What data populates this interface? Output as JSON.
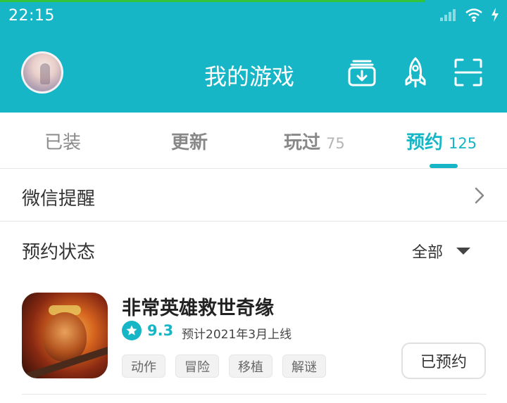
{
  "status_bar": {
    "time": "22:15"
  },
  "header": {
    "title": "我的游戏",
    "accent_color": "#16b6c6",
    "icons": [
      "download-box-icon",
      "rocket-icon",
      "scan-icon"
    ]
  },
  "tabs": [
    {
      "label": "已装",
      "count": ""
    },
    {
      "label": "更新",
      "count": ""
    },
    {
      "label": "玩过",
      "count": "75"
    },
    {
      "label": "预约",
      "count": "125",
      "active": true
    }
  ],
  "wechat_reminder": {
    "label": "微信提醒"
  },
  "reservation_status": {
    "label": "预约状态",
    "filter_value": "全部"
  },
  "games": [
    {
      "title": "非常英雄救世奇缘",
      "rating": "9.3",
      "release_text": "预计2021年3月上线",
      "tags": [
        "动作",
        "冒险",
        "移植",
        "解谜"
      ],
      "action_label": "已预约"
    }
  ]
}
